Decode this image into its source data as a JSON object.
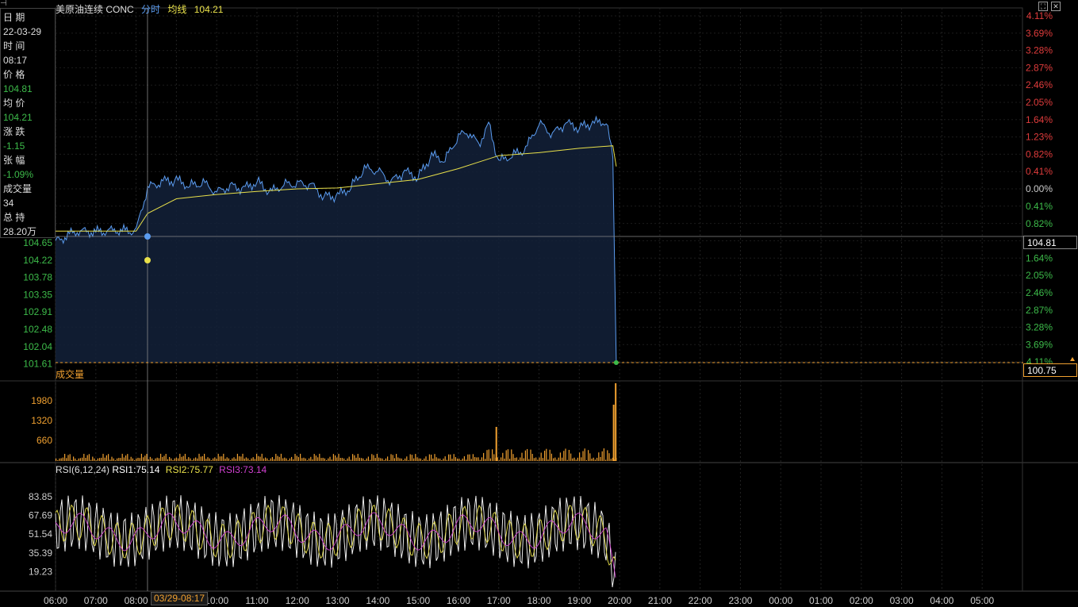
{
  "header": {
    "symbol": "美原油连续 CONC",
    "mode": "分时",
    "avg_label": "均线",
    "avg_value": "104.21"
  },
  "info_panel": {
    "date_label": "日 期",
    "date": "22-03-29",
    "time_label": "时 间",
    "time": "08:17",
    "price_label": "价 格",
    "price": "104.81",
    "avg_label": "均 价",
    "avg": "104.21",
    "change_label": "涨 跌",
    "change": "-1.15",
    "pct_label": "张 幅",
    "pct": "-1.09%",
    "volume_label": "成交量",
    "volume": "34",
    "oi_label": "总 持",
    "oi": "28.20万"
  },
  "price_axis_left": [
    "104.65",
    "104.22",
    "103.78",
    "103.35",
    "102.91",
    "102.48",
    "102.04",
    "101.61"
  ],
  "pct_axis_right_red": [
    "4.11%",
    "3.69%",
    "3.28%",
    "2.87%",
    "2.46%",
    "2.05%",
    "1.64%",
    "1.23%",
    "0.82%",
    "0.41%"
  ],
  "pct_axis_right_zero": "0.00%",
  "pct_axis_right_green": [
    "0.41%",
    "0.82%",
    "1.23%",
    "1.64%",
    "2.05%",
    "2.46%",
    "2.87%",
    "3.28%",
    "3.69%",
    "4.11%"
  ],
  "crosshair_price": "104.81",
  "last_price_tag": "100.75",
  "volume_panel": {
    "label": "成交量",
    "ticks": [
      "1980",
      "1320",
      "660"
    ]
  },
  "rsi_panel": {
    "label": "RSI(6,12,24)",
    "rsi1": "RSI1:75.14",
    "rsi2": "RSI2:75.77",
    "rsi3": "RSI3:73.14",
    "ticks": [
      "83.85",
      "67.69",
      "51.54",
      "35.39",
      "19.23"
    ]
  },
  "time_axis": [
    "06:00",
    "07:00",
    "08:00",
    "09:00",
    "10:00",
    "11:00",
    "12:00",
    "13:00",
    "14:00",
    "15:00",
    "16:00",
    "17:00",
    "18:00",
    "19:00",
    "20:00",
    "21:00",
    "22:00",
    "23:00",
    "00:00",
    "01:00",
    "02:00",
    "03:00",
    "04:00",
    "05:00"
  ],
  "cursor_time_label": "03/29-08:17",
  "colors": {
    "price_line": "#5b9cf0",
    "avg_line": "#e8e04a",
    "volume": "#f0a030",
    "rsi1": "#ffffff",
    "rsi2": "#e8e04a",
    "rsi3": "#d040d0",
    "up": "#e03c3c",
    "down": "#3dbb4a"
  },
  "chart_data": {
    "type": "line",
    "title": "美原油连续 CONC 分时",
    "x_label": "",
    "y_label": "",
    "y_range": [
      100.75,
      104.81
    ],
    "series": [
      {
        "name": "分时",
        "x": [
          "06:00",
          "06:30",
          "07:00",
          "07:30",
          "08:00",
          "08:17",
          "08:40",
          "09:00",
          "09:20",
          "09:40",
          "10:00",
          "10:20",
          "10:40",
          "11:00",
          "11:20",
          "11:40",
          "12:00",
          "12:20",
          "12:40",
          "13:00",
          "13:20",
          "13:40",
          "14:00",
          "14:20",
          "14:40",
          "15:00",
          "15:20",
          "15:40",
          "16:00",
          "16:15",
          "16:30",
          "16:45",
          "17:00",
          "17:10",
          "17:20",
          "17:40",
          "18:00",
          "18:20",
          "18:40",
          "19:00",
          "19:20",
          "19:40",
          "19:50",
          "19:55"
        ],
        "y": [
          103.55,
          103.8,
          103.78,
          103.82,
          103.8,
          104.81,
          104.95,
          104.98,
          104.85,
          104.92,
          104.7,
          104.85,
          104.78,
          104.95,
          104.7,
          104.88,
          104.9,
          104.88,
          104.6,
          104.62,
          104.82,
          105.25,
          105.2,
          104.95,
          105.18,
          105.05,
          105.55,
          105.45,
          106.0,
          106.1,
          105.8,
          106.3,
          105.4,
          105.5,
          105.55,
          105.7,
          106.3,
          106.05,
          106.3,
          106.2,
          106.3,
          106.35,
          105.5,
          100.75
        ]
      },
      {
        "name": "均线",
        "x": [
          "06:00",
          "07:00",
          "08:00",
          "08:17",
          "09:00",
          "10:00",
          "11:00",
          "12:00",
          "13:00",
          "14:00",
          "15:00",
          "16:00",
          "16:30",
          "17:00",
          "18:00",
          "19:00",
          "19:50",
          "19:55"
        ],
        "y": [
          103.8,
          103.8,
          103.8,
          104.21,
          104.55,
          104.65,
          104.72,
          104.78,
          104.8,
          104.9,
          105.0,
          105.25,
          105.4,
          105.55,
          105.62,
          105.72,
          105.78,
          105.3
        ]
      }
    ]
  }
}
